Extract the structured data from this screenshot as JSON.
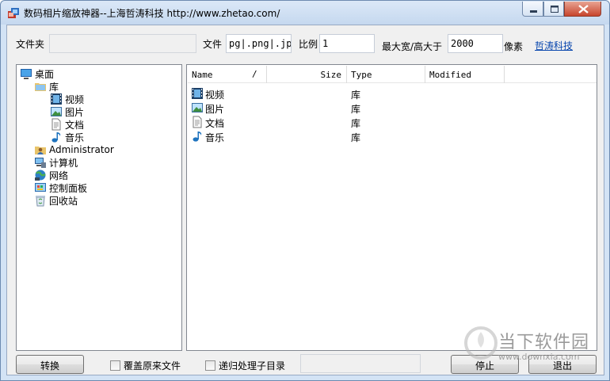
{
  "window": {
    "title": "数码相片缩放神器--上海哲涛科技 http://www.zhetao.com/"
  },
  "toolbar": {
    "folder_label": "文件夹",
    "folder_value": "",
    "file_label": "文件",
    "file_value": "pg|.png|.jpeg",
    "ratio_label": "比例",
    "ratio_value": "1",
    "maxsize_label": "最大宽/高大于",
    "maxsize_value": "2000",
    "unit_label": "像素",
    "company_link": "哲涛科技"
  },
  "tree": {
    "items": [
      {
        "label": "桌面",
        "icon": "desktop-icon"
      },
      {
        "label": "库",
        "icon": "library-folder-icon"
      },
      {
        "label": "视频",
        "icon": "video-library-icon"
      },
      {
        "label": "图片",
        "icon": "picture-library-icon"
      },
      {
        "label": "文档",
        "icon": "document-library-icon"
      },
      {
        "label": "音乐",
        "icon": "music-library-icon"
      },
      {
        "label": "Administrator",
        "icon": "user-folder-icon"
      },
      {
        "label": "计算机",
        "icon": "computer-icon"
      },
      {
        "label": "网络",
        "icon": "network-icon"
      },
      {
        "label": "控制面板",
        "icon": "control-panel-icon"
      },
      {
        "label": "回收站",
        "icon": "recycle-bin-icon"
      }
    ]
  },
  "list": {
    "columns": [
      "Name",
      "Size",
      "Type",
      "Modified"
    ],
    "sort_indicator": "/",
    "rows": [
      {
        "name": "视频",
        "size": "",
        "type": "库",
        "modified": "",
        "icon": "video-library-icon"
      },
      {
        "name": "图片",
        "size": "",
        "type": "库",
        "modified": "",
        "icon": "picture-library-icon"
      },
      {
        "name": "文档",
        "size": "",
        "type": "库",
        "modified": "",
        "icon": "document-library-icon"
      },
      {
        "name": "音乐",
        "size": "",
        "type": "库",
        "modified": "",
        "icon": "music-library-icon"
      }
    ]
  },
  "bottom": {
    "convert_label": "转换",
    "overwrite_label": "覆盖原来文件",
    "overwrite_checked": false,
    "recursive_label": "递归处理子目录",
    "recursive_checked": false,
    "status_value": "",
    "stop_label": "停止",
    "exit_label": "退出"
  },
  "watermark": {
    "text": "当下软件园",
    "url": "www.downxia.com"
  }
}
